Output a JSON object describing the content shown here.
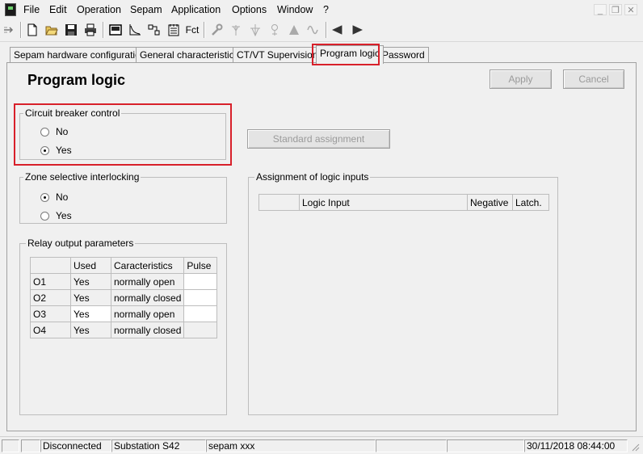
{
  "menu": {
    "items": [
      "File",
      "Edit",
      "Operation",
      "Sepam",
      "Application",
      "Options",
      "Window",
      "?"
    ],
    "mdi": {
      "minimize": "_",
      "restore": "❐",
      "close": "✕"
    }
  },
  "toolbar": {
    "fct_label": "Fct"
  },
  "tabs": [
    {
      "label": "Sepam hardware configuration"
    },
    {
      "label": "General characteristics"
    },
    {
      "label": "CT/VT Supervision"
    },
    {
      "label": "Program logic"
    },
    {
      "label": "Password"
    }
  ],
  "page": {
    "title": "Program logic",
    "apply_label": "Apply",
    "cancel_label": "Cancel",
    "standard_assignment_label": "Standard assignment"
  },
  "circuit_breaker": {
    "label": "Circuit breaker control",
    "options": [
      {
        "label": "No",
        "selected": false
      },
      {
        "label": "Yes",
        "selected": true
      }
    ]
  },
  "zone_interlocking": {
    "label": "Zone selective interlocking",
    "options": [
      {
        "label": "No",
        "selected": true
      },
      {
        "label": "Yes",
        "selected": false
      }
    ]
  },
  "relay_output": {
    "label": "Relay output parameters",
    "headers": [
      "",
      "Used",
      "Caracteristics",
      "Pulse"
    ],
    "rows": [
      [
        "O1",
        "Yes",
        "normally open",
        ""
      ],
      [
        "O2",
        "Yes",
        "normally closed",
        ""
      ],
      [
        "O3",
        "Yes",
        "normally open",
        ""
      ],
      [
        "O4",
        "Yes",
        "normally closed",
        ""
      ]
    ]
  },
  "logic_inputs": {
    "label": "Assignment of logic inputs",
    "headers": [
      "",
      "Logic Input",
      "Negative",
      "Latch."
    ]
  },
  "status": {
    "connection": "Disconnected",
    "substation": "Substation S42",
    "device": "sepam xxx",
    "datetime": "30/11/2018  08:44:00"
  },
  "colors": {
    "highlight": "#d8202a",
    "disabled_text": "#9a9a9a"
  }
}
